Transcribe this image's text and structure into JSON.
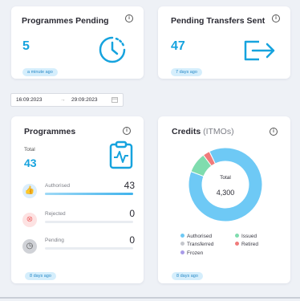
{
  "cards": {
    "programmes_pending": {
      "title": "Programmes Pending",
      "value": "5",
      "updated": "a minute ago"
    },
    "pending_transfers": {
      "title": "Pending Transfers Sent",
      "value": "47",
      "updated": "7 days ago"
    },
    "programmes": {
      "title": "Programmes",
      "total_label": "Total",
      "total": "43",
      "rows": [
        {
          "label": "Authorised",
          "value": "43",
          "fraction": 1.0
        },
        {
          "label": "Rejected",
          "value": "0",
          "fraction": 0
        },
        {
          "label": "Pending",
          "value": "0",
          "fraction": 0
        }
      ],
      "updated": "8 days ago"
    },
    "credits": {
      "title": "Credits",
      "subtitle": "(ITMOs)",
      "center_label": "Total",
      "center_value": "4,300",
      "legend": [
        {
          "label": "Authorised",
          "color": "#6ec9f5"
        },
        {
          "label": "Issued",
          "color": "#7fdcae"
        },
        {
          "label": "Transferred",
          "color": "#c4c6cc"
        },
        {
          "label": "Retired",
          "color": "#f07b7b"
        },
        {
          "label": "Frozen",
          "color": "#a99be8"
        }
      ],
      "updated": "8 days ago"
    }
  },
  "chart_data": {
    "type": "pie",
    "categories": [
      "Authorised",
      "Issued",
      "Transferred",
      "Retired",
      "Frozen"
    ],
    "values": [
      88,
      9,
      0,
      3,
      0
    ]
  },
  "date_range": {
    "start": "16:09:2023",
    "separator": "→",
    "end": "29:09:2023"
  },
  "colors": {
    "accent": "#16a3de",
    "background": "#eef1f6"
  }
}
